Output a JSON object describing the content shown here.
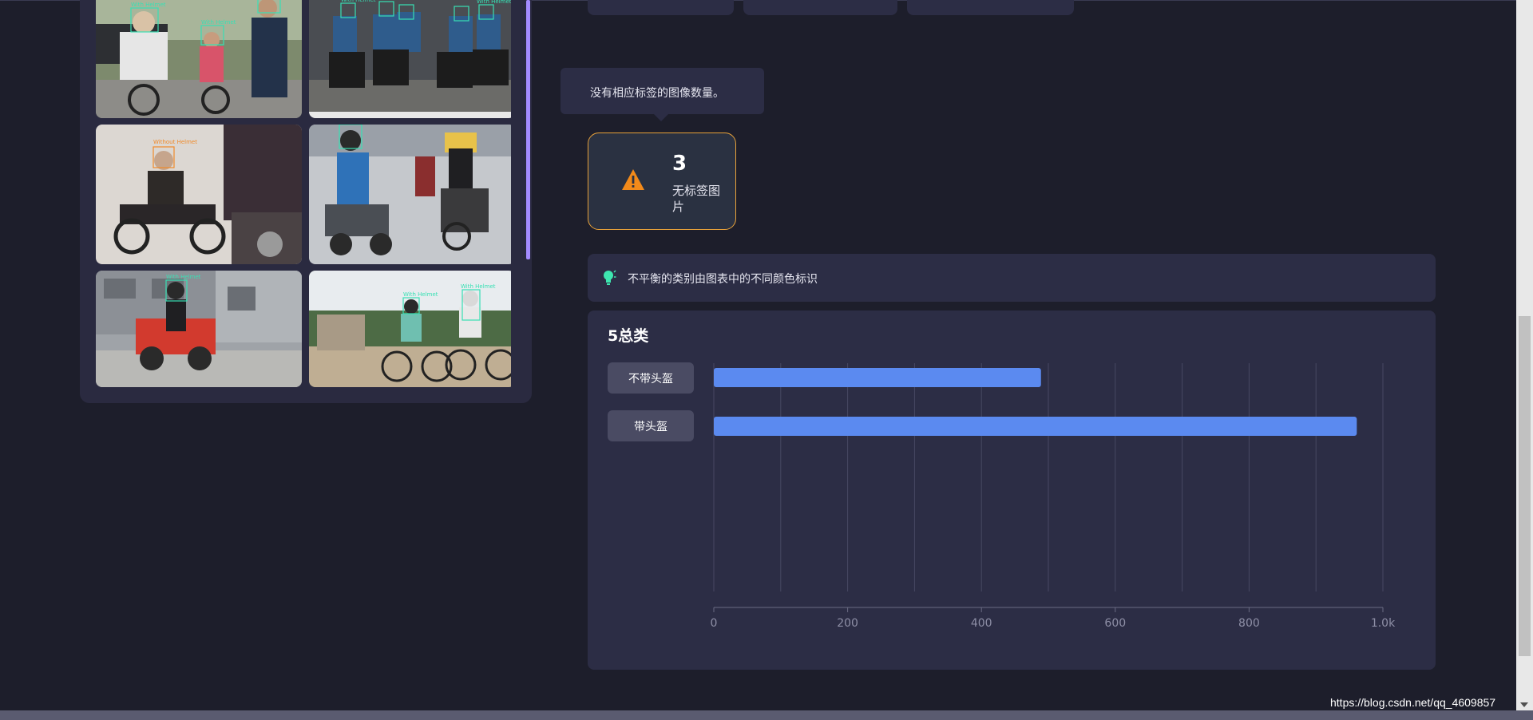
{
  "gallery": {
    "labels": {
      "with_helmet": "With Helmet",
      "without_helmet": "Without Helmet"
    }
  },
  "tooltip": {
    "text": "没有相应标签的图像数量。"
  },
  "unlabeled_stat": {
    "value": "3",
    "label": "无标签图片",
    "icon": "warning-icon",
    "accent": "#e8a23a"
  },
  "hint": {
    "icon": "lightbulb-icon",
    "text": "不平衡的类别由图表中的不同颜色标识"
  },
  "chart_data": {
    "type": "bar",
    "orientation": "horizontal",
    "title": "5总类",
    "categories": [
      "不带头盔",
      "带头盔"
    ],
    "values": [
      489,
      961
    ],
    "xlim": [
      0,
      1000
    ],
    "xticks": [
      "0",
      "200",
      "400",
      "600",
      "800",
      "1.0k"
    ],
    "grid": true,
    "bar_color": "#5b8af0"
  },
  "watermark": "https://blog.csdn.net/qq_4609857"
}
